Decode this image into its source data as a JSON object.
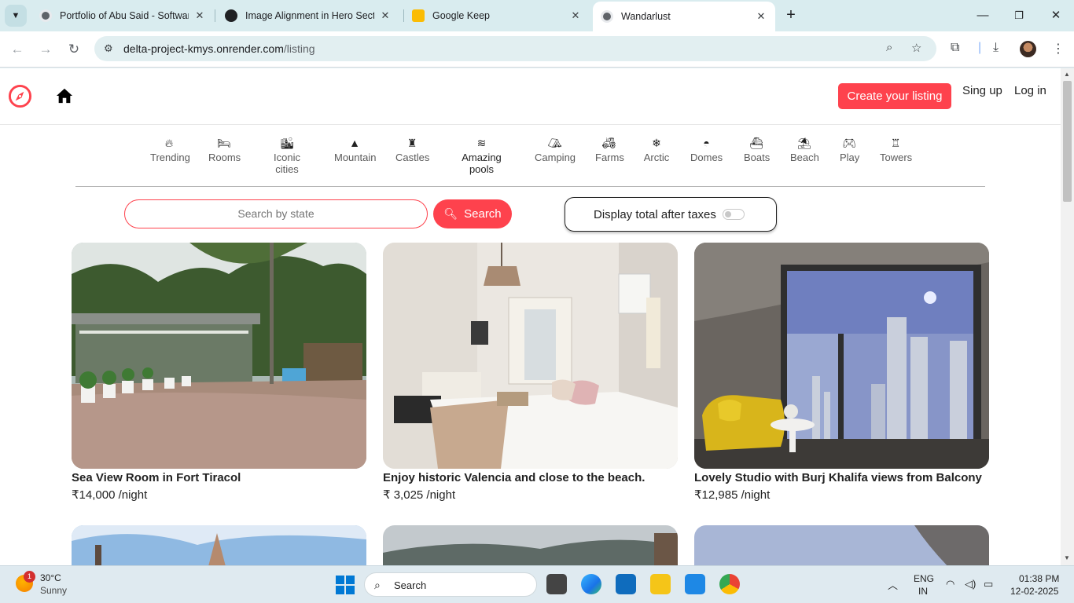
{
  "browser": {
    "tabs": [
      {
        "title": "Portfolio of Abu Said - Software",
        "active": false
      },
      {
        "title": "Image Alignment in Hero Sectio",
        "active": false
      },
      {
        "title": "Google Keep",
        "active": false
      },
      {
        "title": "Wandarlust",
        "active": true
      }
    ],
    "url_host": "delta-project-kmys.onrender.com",
    "url_path": "/listing"
  },
  "site": {
    "create_label": "Create your listing",
    "signup_label": "Sing up",
    "login_label": "Log in",
    "filters": [
      {
        "label": "Trending",
        "icon": "fire-icon"
      },
      {
        "label": "Rooms",
        "icon": "bed-icon"
      },
      {
        "label": "Iconic cities",
        "icon": "city-icon"
      },
      {
        "label": "Mountain",
        "icon": "mountain-icon"
      },
      {
        "label": "Castles",
        "icon": "castle-icon"
      },
      {
        "label": "Amazing pools",
        "icon": "swimmer-icon"
      },
      {
        "label": "Camping",
        "icon": "tent-icon"
      },
      {
        "label": "Farms",
        "icon": "tractor-icon"
      },
      {
        "label": "Arctic",
        "icon": "snowflake-icon"
      },
      {
        "label": "Domes",
        "icon": "dome-icon"
      },
      {
        "label": "Boats",
        "icon": "ship-icon"
      },
      {
        "label": "Beach",
        "icon": "umbrella-beach-icon"
      },
      {
        "label": "Play",
        "icon": "gamepad-icon"
      },
      {
        "label": "Towers",
        "icon": "tower-icon"
      }
    ],
    "search_placeholder": "Search by state",
    "search_label": "Search",
    "tax_label": "Display total after taxes",
    "listings": [
      {
        "title": "Sea View Room in Fort Tiracol",
        "price": "₹14,000 /night"
      },
      {
        "title": "Enjoy historic Valencia and close to the beach.",
        "price": "₹ 3,025 /night"
      },
      {
        "title": "Lovely Studio with Burj Khalifa views from Balcony",
        "price": "₹12,985 /night"
      }
    ]
  },
  "taskbar": {
    "weather_temp": "30°C",
    "weather_cond": "Sunny",
    "weather_badge": "1",
    "search_label": "Search",
    "lang_top": "ENG",
    "lang_bottom": "IN",
    "time": "01:38 PM",
    "date": "12-02-2025"
  },
  "colors": {
    "accent": "#fe424d"
  }
}
